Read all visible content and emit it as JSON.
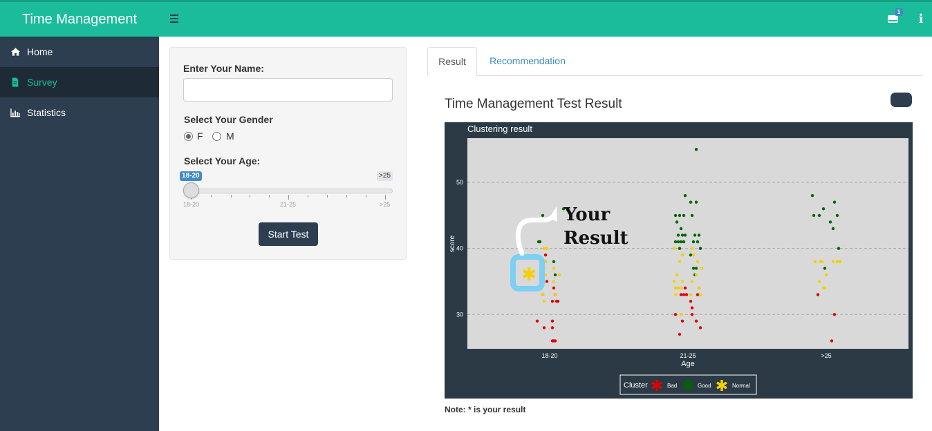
{
  "header": {
    "app_title": "Time Management",
    "mail_badge": "1",
    "icons": {
      "menu": "hamburger-icon",
      "mail": "envelope-icon",
      "info": "info-icon"
    }
  },
  "sidebar": {
    "items": [
      {
        "label": "Home",
        "icon": "home-icon",
        "active": false
      },
      {
        "label": "Survey",
        "icon": "file-icon",
        "active": true
      },
      {
        "label": "Statistics",
        "icon": "bar-chart-icon",
        "active": false
      }
    ]
  },
  "form": {
    "name_label": "Enter Your Name:",
    "name_value": "",
    "gender_label": "Select Your Gender",
    "gender_options": [
      "F",
      "M"
    ],
    "gender_selected": "F",
    "age_label": "Select Your Age:",
    "age_slider": {
      "min_tag": "18-20",
      "max_tag": ">25",
      "ticks": [
        "18-20",
        "21-25",
        ">25"
      ],
      "value": "18-20"
    },
    "start_label": "Start Test"
  },
  "tabs": [
    {
      "label": "Result",
      "active": true
    },
    {
      "label": "Recommendation",
      "active": false
    }
  ],
  "result": {
    "title": "Time Management Test Result",
    "note": "Note: * is your result",
    "annotation_line1": "Your",
    "annotation_line2": "Result"
  },
  "colors": {
    "brand": "#1abc9c",
    "sidebar": "#2c3e50",
    "bad": "#e00000",
    "good": "#006400",
    "normal": "#f5d000"
  },
  "chart_data": {
    "type": "scatter",
    "title": "Clustering result",
    "xlabel": "Age",
    "ylabel": "score",
    "categories": [
      "18-20",
      "21-25",
      ">25"
    ],
    "ylim": [
      24.8,
      56.7
    ],
    "yticks": [
      30,
      40,
      50
    ],
    "grid": true,
    "legend": {
      "title": "Cluster",
      "placement": "bottom",
      "entries": [
        "Bad",
        "Good",
        "Normal"
      ]
    },
    "series": [
      {
        "name": "Bad",
        "points": [
          [
            -0.03,
            39
          ],
          [
            -0.03,
            38
          ],
          [
            -0.06,
            35
          ],
          [
            -0.02,
            35
          ],
          [
            -0.06,
            34
          ],
          [
            0.03,
            34
          ],
          [
            0.04,
            33
          ],
          [
            -0.05,
            33
          ],
          [
            0.02,
            32
          ],
          [
            0.06,
            32
          ],
          [
            0.05,
            32
          ],
          [
            -0.09,
            29
          ],
          [
            0.02,
            29
          ],
          [
            -0.04,
            28
          ],
          [
            0.02,
            28
          ],
          [
            0.02,
            26
          ],
          [
            0.03,
            26
          ],
          [
            0.04,
            26
          ],
          [
            -0.09,
            30
          ],
          [
            -0.04,
            29
          ],
          [
            -0.02,
            34
          ],
          [
            -0.05,
            33
          ],
          [
            -0.03,
            33
          ],
          [
            -0.01,
            33
          ],
          [
            0.07,
            33
          ],
          [
            0.08,
            34
          ],
          [
            0.02,
            32
          ],
          [
            0.03,
            31
          ],
          [
            0.06,
            29
          ],
          [
            0.09,
            28
          ],
          [
            -0.06,
            27
          ],
          [
            0.03,
            30
          ],
          [
            -0.06,
            33
          ],
          [
            0.06,
            30
          ],
          [
            0.04,
            26
          ]
        ]
      },
      {
        "name": "Good",
        "points": [
          [
            -0.05,
            45
          ],
          [
            -0.08,
            41
          ],
          [
            -0.07,
            41
          ],
          [
            0.03,
            38
          ],
          [
            0.04,
            36
          ],
          [
            0.1,
            46
          ],
          [
            -0.09,
            45
          ],
          [
            -0.08,
            44
          ],
          [
            -0.06,
            45
          ],
          [
            -0.03,
            45
          ],
          [
            0.03,
            45
          ],
          [
            -0.02,
            48
          ],
          [
            0.02,
            47
          ],
          [
            0.06,
            47
          ],
          [
            -0.07,
            42
          ],
          [
            -0.05,
            43
          ],
          [
            -0.04,
            42
          ],
          [
            -0.02,
            42
          ],
          [
            0.05,
            42
          ],
          [
            0.08,
            42
          ],
          [
            -0.09,
            41
          ],
          [
            -0.07,
            41
          ],
          [
            -0.05,
            41
          ],
          [
            -0.03,
            41
          ],
          [
            0.04,
            41
          ],
          [
            0.07,
            41
          ],
          [
            0.09,
            40
          ],
          [
            0.02,
            39
          ],
          [
            0.04,
            37
          ],
          [
            0.06,
            37
          ],
          [
            0.05,
            36
          ],
          [
            0.06,
            55
          ],
          [
            -0.06,
            40
          ],
          [
            -0.05,
            45
          ],
          [
            -0.02,
            46
          ],
          [
            0.05,
            43
          ],
          [
            -0.1,
            48
          ],
          [
            0.06,
            47
          ],
          [
            0.08,
            45
          ],
          [
            0.03,
            44
          ],
          [
            -0.09,
            45
          ],
          [
            -0.01,
            37
          ],
          [
            0.09,
            40
          ]
        ]
      },
      {
        "name": "Normal",
        "points": [
          [
            -0.04,
            40
          ],
          [
            -0.02,
            40
          ],
          [
            -0.03,
            38
          ],
          [
            0.03,
            37
          ],
          [
            -0.04,
            37
          ],
          [
            -0.03,
            36
          ],
          [
            0.07,
            36
          ],
          [
            -0.05,
            35
          ],
          [
            0.03,
            35
          ],
          [
            0.04,
            33
          ],
          [
            -0.05,
            33
          ],
          [
            -0.04,
            32
          ],
          [
            -0.1,
            40
          ],
          [
            -0.04,
            39
          ],
          [
            0.03,
            40
          ],
          [
            0.04,
            39
          ],
          [
            -0.06,
            38
          ],
          [
            0.07,
            38
          ],
          [
            0.1,
            37
          ],
          [
            -0.08,
            36
          ],
          [
            0.06,
            36
          ],
          [
            -0.1,
            35
          ],
          [
            0.03,
            35
          ],
          [
            -0.09,
            34
          ],
          [
            -0.07,
            34
          ],
          [
            -0.05,
            34
          ],
          [
            0.08,
            34
          ],
          [
            -0.09,
            33
          ],
          [
            0.02,
            33
          ],
          [
            0.09,
            33
          ],
          [
            -0.04,
            35
          ],
          [
            -0.05,
            30
          ],
          [
            -0.08,
            38
          ],
          [
            -0.04,
            38
          ],
          [
            -0.03,
            38
          ],
          [
            0.05,
            38
          ],
          [
            0.08,
            38
          ],
          [
            0.1,
            38
          ],
          [
            -0.01,
            34
          ],
          [
            -0.05,
            35
          ],
          [
            -0.02,
            34
          ],
          [
            0.0,
            36
          ]
        ]
      }
    ],
    "your_result": {
      "category": "18-20",
      "jitter": -0.15,
      "score": 36,
      "cluster": "Normal"
    }
  }
}
